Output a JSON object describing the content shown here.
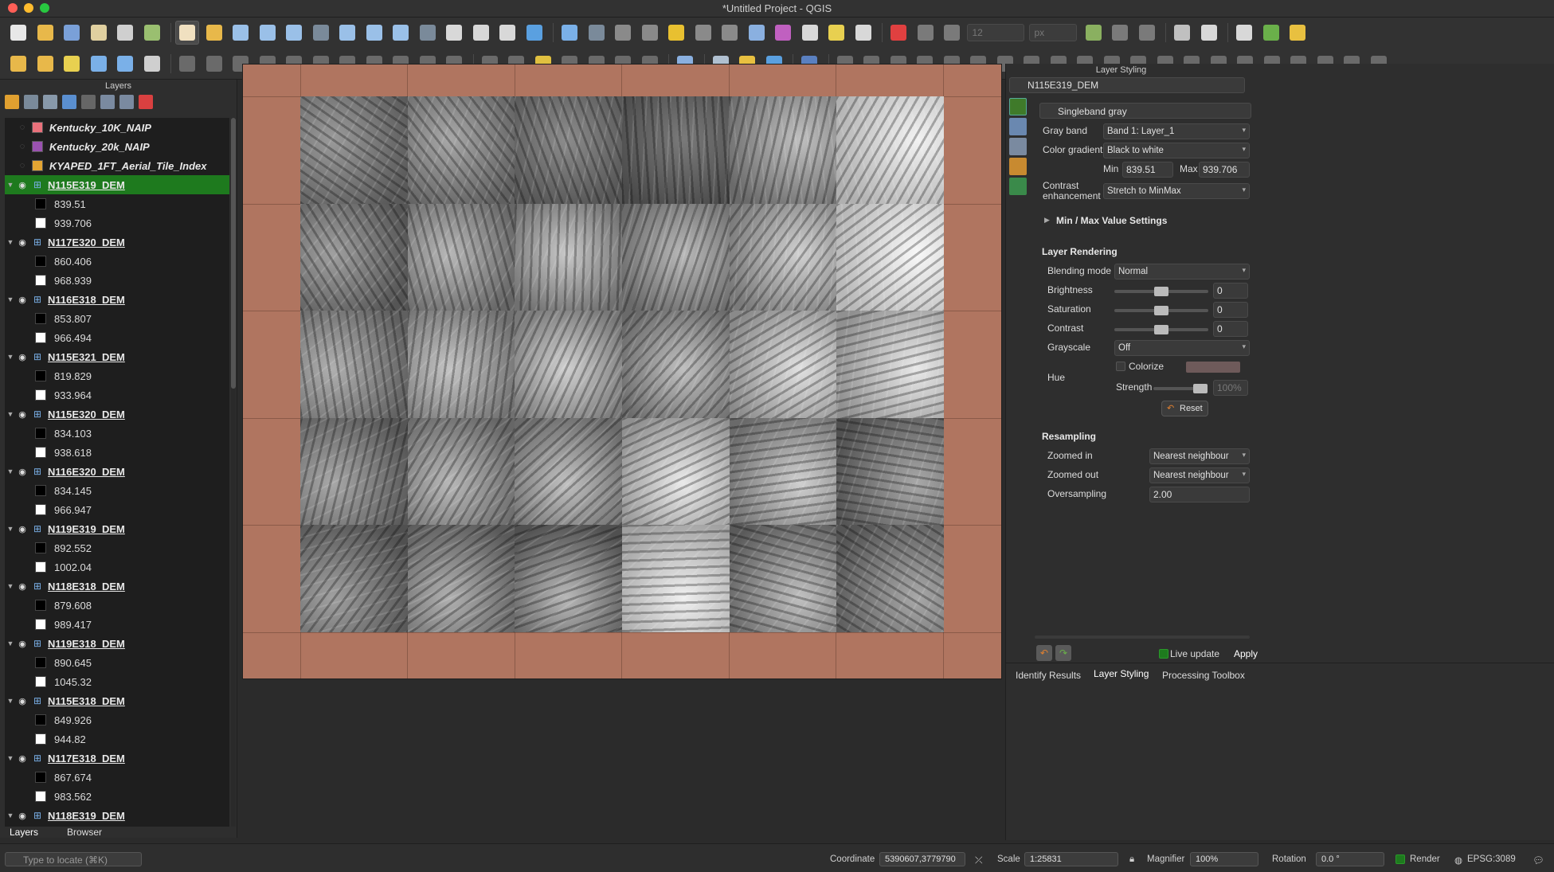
{
  "window": {
    "title": "*Untitled Project - QGIS"
  },
  "toolbar": {
    "field_size": "12",
    "field_unit": "px"
  },
  "layers_panel": {
    "title": "Layers",
    "vector_layers": [
      {
        "name": "Kentucky_10K_NAIP",
        "color": "#e9717b"
      },
      {
        "name": "Kentucky_20k_NAIP",
        "color": "#9a52b0"
      },
      {
        "name": "KYAPED_1FT_Aerial_Tile_Index",
        "color": "#e4a533"
      }
    ],
    "raster_layers": [
      {
        "name": "N115E319_DEM",
        "min": "839.51",
        "max": "939.706",
        "selected": true
      },
      {
        "name": "N117E320_DEM",
        "min": "860.406",
        "max": "968.939"
      },
      {
        "name": "N116E318_DEM",
        "min": "853.807",
        "max": "966.494"
      },
      {
        "name": "N115E321_DEM",
        "min": "819.829",
        "max": "933.964"
      },
      {
        "name": "N115E320_DEM",
        "min": "834.103",
        "max": "938.618"
      },
      {
        "name": "N116E320_DEM",
        "min": "834.145",
        "max": "966.947"
      },
      {
        "name": "N119E319_DEM",
        "min": "892.552",
        "max": "1002.04"
      },
      {
        "name": "N118E318_DEM",
        "min": "879.608",
        "max": "989.417"
      },
      {
        "name": "N119E318_DEM",
        "min": "890.645",
        "max": "1045.32"
      },
      {
        "name": "N115E318_DEM",
        "min": "849.926",
        "max": "944.82"
      },
      {
        "name": "N117E318_DEM",
        "min": "867.674",
        "max": "983.562"
      },
      {
        "name": "N118E319_DEM",
        "min": "",
        "max": ""
      }
    ],
    "tabs": [
      "Layers",
      "Browser"
    ]
  },
  "styling": {
    "title": "Layer Styling",
    "layer": "N115E319_DEM",
    "renderer": "Singleband gray",
    "gray_band_label": "Gray band",
    "gray_band": "Band 1: Layer_1",
    "color_gradient_label": "Color gradient",
    "color_gradient": "Black to white",
    "min_label": "Min",
    "min": "839.51",
    "max_label": "Max",
    "max": "939.706",
    "contrast_label_1": "Contrast",
    "contrast_label_2": "enhancement",
    "contrast": "Stretch to MinMax",
    "minmax_section": "Min / Max Value Settings",
    "rendering_section": "Layer Rendering",
    "blending_label": "Blending mode",
    "blending": "Normal",
    "brightness_label": "Brightness",
    "brightness": "0",
    "saturation_label": "Saturation",
    "saturation": "0",
    "contrast2_label": "Contrast",
    "contrast2": "0",
    "grayscale_label": "Grayscale",
    "grayscale": "Off",
    "hue_label": "Hue",
    "colorize_label": "Colorize",
    "strength_label": "Strength",
    "strength": "100%",
    "reset_label": "Reset",
    "resampling_section": "Resampling",
    "zoomed_in_label": "Zoomed in",
    "zoomed_in": "Nearest neighbour",
    "zoomed_out_label": "Zoomed out",
    "zoomed_out": "Nearest neighbour",
    "oversampling_label": "Oversampling",
    "oversampling": "2.00",
    "live_update": "Live update",
    "apply": "Apply",
    "bottom_tabs": [
      "Identify Results",
      "Layer Styling",
      "Processing Toolbox"
    ]
  },
  "statusbar": {
    "locator_placeholder": "Type to locate (⌘K)",
    "coordinate_label": "Coordinate",
    "coordinate": "5390607,3779790",
    "scale_label": "Scale",
    "scale": "1:25831",
    "magnifier_label": "Magnifier",
    "magnifier": "100%",
    "rotation_label": "Rotation",
    "rotation": "0.0 °",
    "render_label": "Render",
    "crs": "EPSG:3089"
  },
  "colors": {
    "map_background": "#b07560",
    "selection": "#1e7a1e"
  }
}
